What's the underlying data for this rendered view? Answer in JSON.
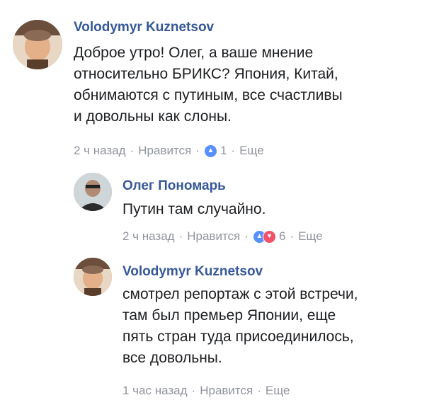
{
  "comments": [
    {
      "author": "Volodymyr Kuznetsov",
      "lines": [
        "Доброе утро! Олег, а ваше мнение",
        "относительно БРИКС? Япония, Китай,",
        "обнимаются с путиным, все счастливы",
        "и довольны как слоны."
      ],
      "time": "2 ч назад",
      "like_label": "Нравится",
      "reactions_count": "1",
      "reply_label": "Еще"
    },
    {
      "author": "Олег Пономарь",
      "lines": [
        "Путин там случайно."
      ],
      "time": "2 ч назад",
      "like_label": "Нравится",
      "reactions_count": "6",
      "reply_label": "Еще"
    },
    {
      "author": "Volodymyr Kuznetsov",
      "lines": [
        "смотрел репортаж с этой встречи,",
        "там был премьер Японии, еще",
        "пять стран туда присоединилось,",
        "все довольны."
      ],
      "time": "1 час назад",
      "like_label": "Нравится",
      "reply_label": "Еще"
    }
  ],
  "separator": "·",
  "colors": {
    "author": "#365899",
    "meta": "#90949c",
    "like": "#5890ff",
    "love": "#f25268"
  },
  "icons": [
    "avatar",
    "like-reaction-icon",
    "love-reaction-icon"
  ]
}
